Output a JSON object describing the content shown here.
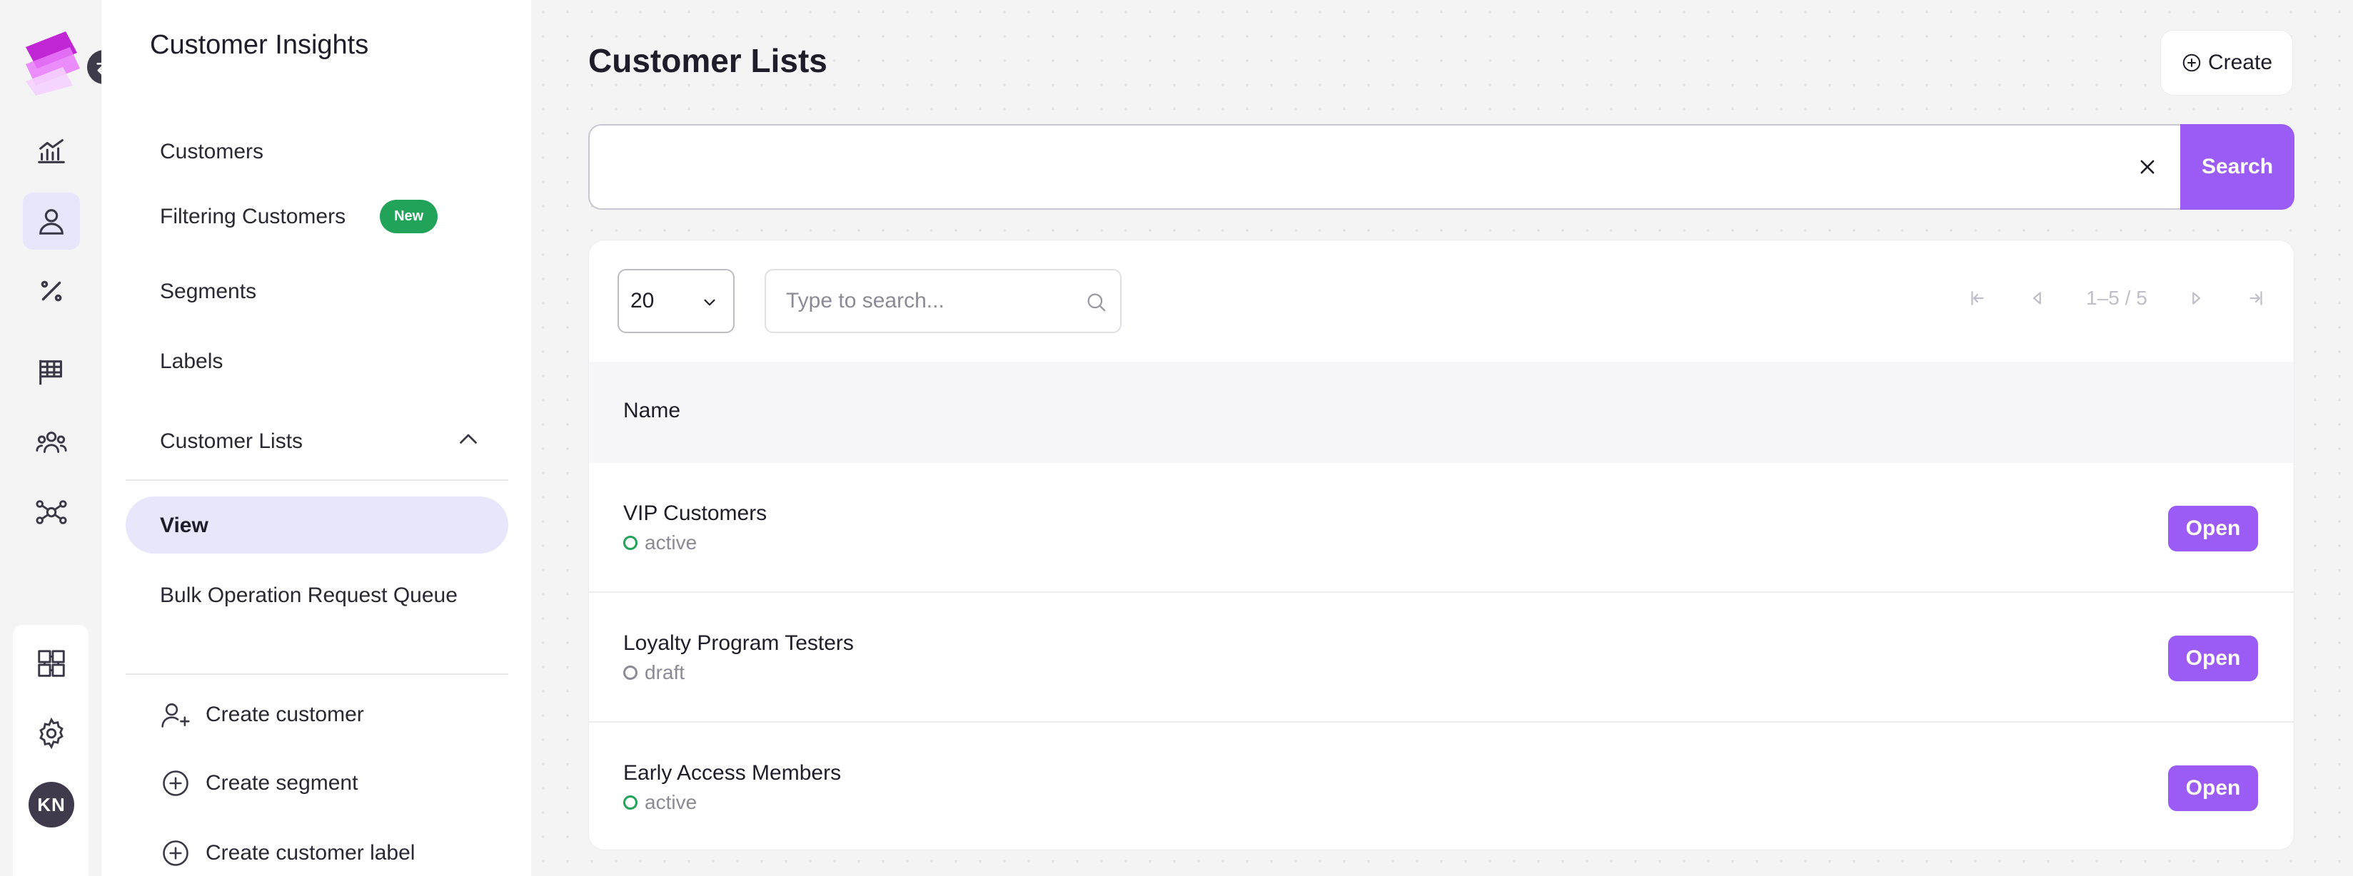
{
  "colors": {
    "accent": "#9b5cf6",
    "active_status": "#22a35a",
    "new_badge": "#22a35a",
    "nav_highlight": "#e8e6fb"
  },
  "rail": {
    "icons": [
      "logo-icon",
      "swap-icon",
      "analytics-icon",
      "user-icon",
      "percent-icon",
      "flag-icon",
      "team-icon",
      "network-icon",
      "integrations-icon",
      "settings-icon"
    ],
    "avatar_initials": "KN"
  },
  "sidebar": {
    "title": "Customer Insights",
    "items": [
      {
        "label": "Customers"
      },
      {
        "label": "Filtering Customers",
        "badge": "New"
      },
      {
        "label": "Segments"
      },
      {
        "label": "Labels"
      },
      {
        "label": "Customer Lists"
      }
    ],
    "sub_items": [
      {
        "label": "View"
      },
      {
        "label": "Bulk Operation Request Queue"
      }
    ],
    "actions": [
      {
        "label": "Create customer"
      },
      {
        "label": "Create segment"
      },
      {
        "label": "Create customer label"
      }
    ]
  },
  "main": {
    "title": "Customer Lists",
    "create_label": "Create",
    "search": {
      "value": "",
      "button_label": "Search"
    },
    "page_size": "20",
    "filter_placeholder": "Type to search...",
    "pagination": "1–5 / 5",
    "table": {
      "column_header": "Name",
      "rows": [
        {
          "name": "VIP Customers",
          "status": "active",
          "action": "Open"
        },
        {
          "name": "Loyalty Program Testers",
          "status": "draft",
          "action": "Open"
        },
        {
          "name": "Early Access Members",
          "status": "active",
          "action": "Open"
        }
      ]
    }
  }
}
